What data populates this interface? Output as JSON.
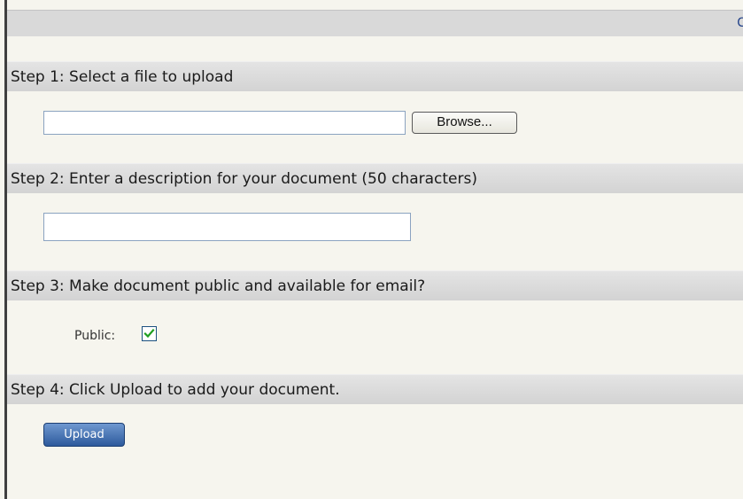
{
  "header": {
    "right_text": "C"
  },
  "steps": [
    {
      "title": "Step 1: Select a file to upload"
    },
    {
      "title": "Step 2: Enter a description for your document (50 characters)"
    },
    {
      "title": "Step 3: Make document public and available for email?"
    },
    {
      "title": "Step 4: Click Upload to add your document."
    }
  ],
  "file_input": {
    "value": "",
    "browse_label": "Browse..."
  },
  "description_input": {
    "value": ""
  },
  "public": {
    "label": "Public:",
    "checked": true
  },
  "upload": {
    "label": "Upload"
  },
  "colors": {
    "accent": "#2d5a9c",
    "checkmark": "#1e9e1e"
  }
}
